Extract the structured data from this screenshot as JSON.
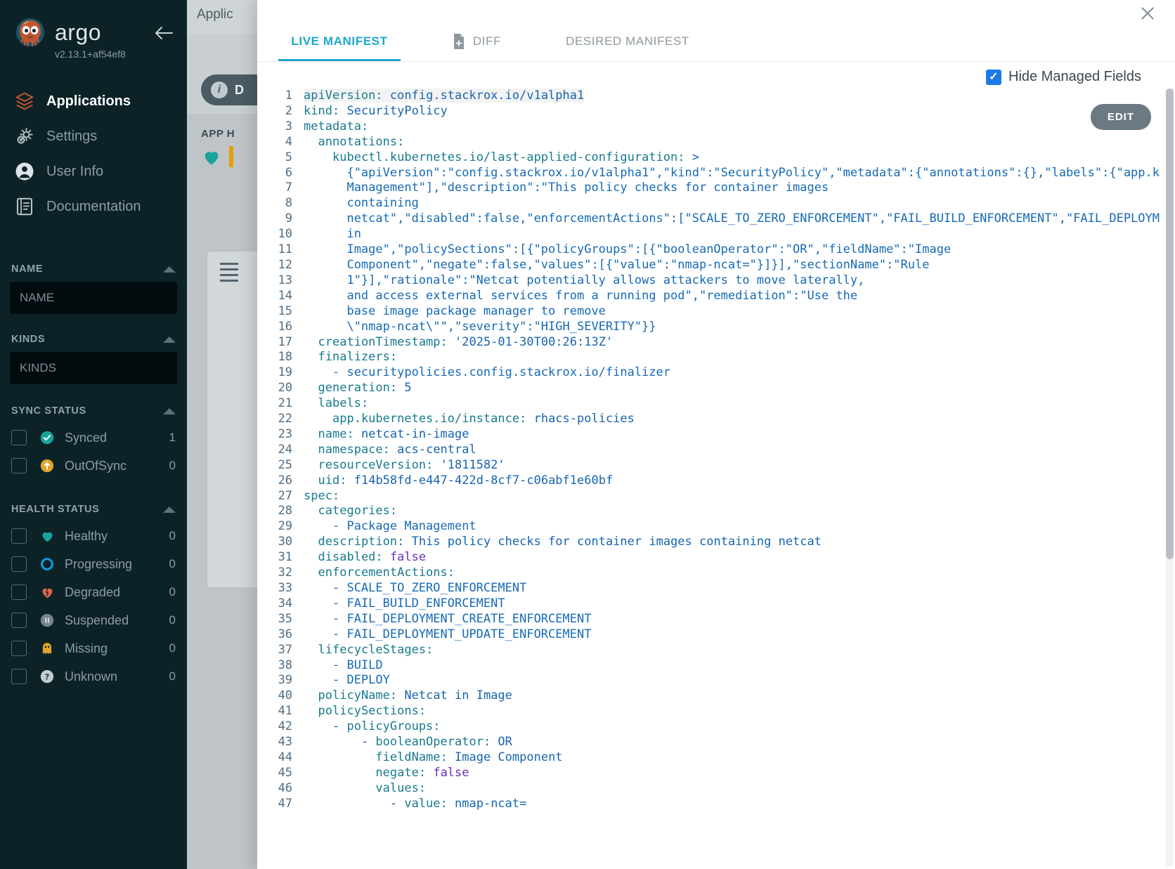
{
  "sidebar": {
    "brand": "argo",
    "version": "v2.13.1+af54ef8",
    "collapse_icon": "arrow-left-icon",
    "nav": [
      {
        "label": "Applications",
        "icon": "layers-icon",
        "active": true
      },
      {
        "label": "Settings",
        "icon": "gear-icon",
        "active": false
      },
      {
        "label": "User Info",
        "icon": "user-circle-icon",
        "active": false
      },
      {
        "label": "Documentation",
        "icon": "book-icon",
        "active": false
      }
    ],
    "filters": [
      {
        "title": "NAME",
        "type": "input",
        "placeholder": "NAME",
        "value": ""
      },
      {
        "title": "KINDS",
        "type": "input",
        "placeholder": "KINDS",
        "value": ""
      },
      {
        "title": "SYNC STATUS",
        "type": "checklist",
        "rows": [
          {
            "label": "Synced",
            "count": "1",
            "icon": "check-circle-icon",
            "color": "#1aa39a"
          },
          {
            "label": "OutOfSync",
            "count": "0",
            "icon": "arrow-up-circle-icon",
            "color": "#e2a42b"
          }
        ]
      },
      {
        "title": "HEALTH STATUS",
        "type": "checklist",
        "rows": [
          {
            "label": "Healthy",
            "count": "0",
            "icon": "heart-icon",
            "color": "#1aa39a"
          },
          {
            "label": "Progressing",
            "count": "0",
            "icon": "circle-outline-icon",
            "color": "#0f9ed5"
          },
          {
            "label": "Degraded",
            "count": "0",
            "icon": "heart-broken-icon",
            "color": "#d9654b"
          },
          {
            "label": "Suspended",
            "count": "0",
            "icon": "pause-circle-icon",
            "color": "#76858d"
          },
          {
            "label": "Missing",
            "count": "0",
            "icon": "ghost-icon",
            "color": "#e2a42b"
          },
          {
            "label": "Unknown",
            "count": "0",
            "icon": "question-circle-icon",
            "color": "#9aa6ad"
          }
        ]
      }
    ]
  },
  "background": {
    "breadcrumb": "Applic",
    "pill_label": "D",
    "section_title": "APP H"
  },
  "modal": {
    "close_icon": "close-icon",
    "tabs": [
      {
        "label": "LIVE MANIFEST",
        "icon": null,
        "active": true
      },
      {
        "label": "DIFF",
        "icon": "diff-file-icon",
        "active": false
      },
      {
        "label": "DESIRED MANIFEST",
        "icon": null,
        "active": false
      }
    ],
    "hide_managed_fields": {
      "label": "Hide Managed Fields",
      "checked": true,
      "check_glyph": "✓"
    },
    "edit_button": "EDIT"
  },
  "code": {
    "language": "yaml",
    "lines": [
      {
        "n": 1,
        "indent": 0,
        "text": "apiVersion: config.stackrox.io/v1alpha1"
      },
      {
        "n": 2,
        "indent": 0,
        "text": "kind: SecurityPolicy"
      },
      {
        "n": 3,
        "indent": 0,
        "text": "metadata:"
      },
      {
        "n": 4,
        "indent": 1,
        "text": "  annotations:"
      },
      {
        "n": 5,
        "indent": 2,
        "text": "    kubectl.kubernetes.io/last-applied-configuration: >"
      },
      {
        "n": 6,
        "indent": 3,
        "text": "      {\"apiVersion\":\"config.stackrox.io/v1alpha1\",\"kind\":\"SecurityPolicy\",\"metadata\":{\"annotations\":{},\"labels\":{\"app.k"
      },
      {
        "n": 7,
        "indent": 3,
        "text": "      Management\"],\"description\":\"This policy checks for container images"
      },
      {
        "n": 8,
        "indent": 3,
        "text": "      containing"
      },
      {
        "n": 9,
        "indent": 3,
        "text": "      netcat\",\"disabled\":false,\"enforcementActions\":[\"SCALE_TO_ZERO_ENFORCEMENT\",\"FAIL_BUILD_ENFORCEMENT\",\"FAIL_DEPLOYM"
      },
      {
        "n": 10,
        "indent": 3,
        "text": "      in"
      },
      {
        "n": 11,
        "indent": 3,
        "text": "      Image\",\"policySections\":[{\"policyGroups\":[{\"booleanOperator\":\"OR\",\"fieldName\":\"Image"
      },
      {
        "n": 12,
        "indent": 3,
        "text": "      Component\",\"negate\":false,\"values\":[{\"value\":\"nmap-ncat=\"}]}],\"sectionName\":\"Rule"
      },
      {
        "n": 13,
        "indent": 3,
        "text": "      1\"}],\"rationale\":\"Netcat potentially allows attackers to move laterally,"
      },
      {
        "n": 14,
        "indent": 3,
        "text": "      and access external services from a running pod\",\"remediation\":\"Use the"
      },
      {
        "n": 15,
        "indent": 3,
        "text": "      base image package manager to remove"
      },
      {
        "n": 16,
        "indent": 3,
        "text": "      \\\"nmap-ncat\\\"\",\"severity\":\"HIGH_SEVERITY\"}}"
      },
      {
        "n": 17,
        "indent": 1,
        "text": "  creationTimestamp: '2025-01-30T00:26:13Z'"
      },
      {
        "n": 18,
        "indent": 1,
        "text": "  finalizers:"
      },
      {
        "n": 19,
        "indent": 2,
        "text": "    - securitypolicies.config.stackrox.io/finalizer"
      },
      {
        "n": 20,
        "indent": 1,
        "text": "  generation: 5"
      },
      {
        "n": 21,
        "indent": 1,
        "text": "  labels:"
      },
      {
        "n": 22,
        "indent": 2,
        "text": "    app.kubernetes.io/instance: rhacs-policies"
      },
      {
        "n": 23,
        "indent": 1,
        "text": "  name: netcat-in-image"
      },
      {
        "n": 24,
        "indent": 1,
        "text": "  namespace: acs-central"
      },
      {
        "n": 25,
        "indent": 1,
        "text": "  resourceVersion: '1811582'"
      },
      {
        "n": 26,
        "indent": 1,
        "text": "  uid: f14b58fd-e447-422d-8cf7-c06abf1e60bf"
      },
      {
        "n": 27,
        "indent": 0,
        "text": "spec:"
      },
      {
        "n": 28,
        "indent": 1,
        "text": "  categories:"
      },
      {
        "n": 29,
        "indent": 2,
        "text": "    - Package Management"
      },
      {
        "n": 30,
        "indent": 1,
        "text": "  description: This policy checks for container images containing netcat"
      },
      {
        "n": 31,
        "indent": 1,
        "text": "  disabled: false"
      },
      {
        "n": 32,
        "indent": 1,
        "text": "  enforcementActions:"
      },
      {
        "n": 33,
        "indent": 2,
        "text": "    - SCALE_TO_ZERO_ENFORCEMENT"
      },
      {
        "n": 34,
        "indent": 2,
        "text": "    - FAIL_BUILD_ENFORCEMENT"
      },
      {
        "n": 35,
        "indent": 2,
        "text": "    - FAIL_DEPLOYMENT_CREATE_ENFORCEMENT"
      },
      {
        "n": 36,
        "indent": 2,
        "text": "    - FAIL_DEPLOYMENT_UPDATE_ENFORCEMENT"
      },
      {
        "n": 37,
        "indent": 1,
        "text": "  lifecycleStages:"
      },
      {
        "n": 38,
        "indent": 2,
        "text": "    - BUILD"
      },
      {
        "n": 39,
        "indent": 2,
        "text": "    - DEPLOY"
      },
      {
        "n": 40,
        "indent": 1,
        "text": "  policyName: Netcat in Image"
      },
      {
        "n": 41,
        "indent": 1,
        "text": "  policySections:"
      },
      {
        "n": 42,
        "indent": 2,
        "text": "    - policyGroups:"
      },
      {
        "n": 43,
        "indent": 3,
        "text": "        - booleanOperator: OR"
      },
      {
        "n": 44,
        "indent": 4,
        "text": "          fieldName: Image Component"
      },
      {
        "n": 45,
        "indent": 4,
        "text": "          negate: false"
      },
      {
        "n": 46,
        "indent": 4,
        "text": "          values:"
      },
      {
        "n": 47,
        "indent": 5,
        "text": "            - value: nmap-ncat="
      }
    ]
  },
  "colors": {
    "sidebar_bg": "#0c2227",
    "accent": "#1ba8cf",
    "code_text": "#166ab5",
    "code_key": "#177a8e",
    "checkbox_blue": "#1b79e8"
  }
}
